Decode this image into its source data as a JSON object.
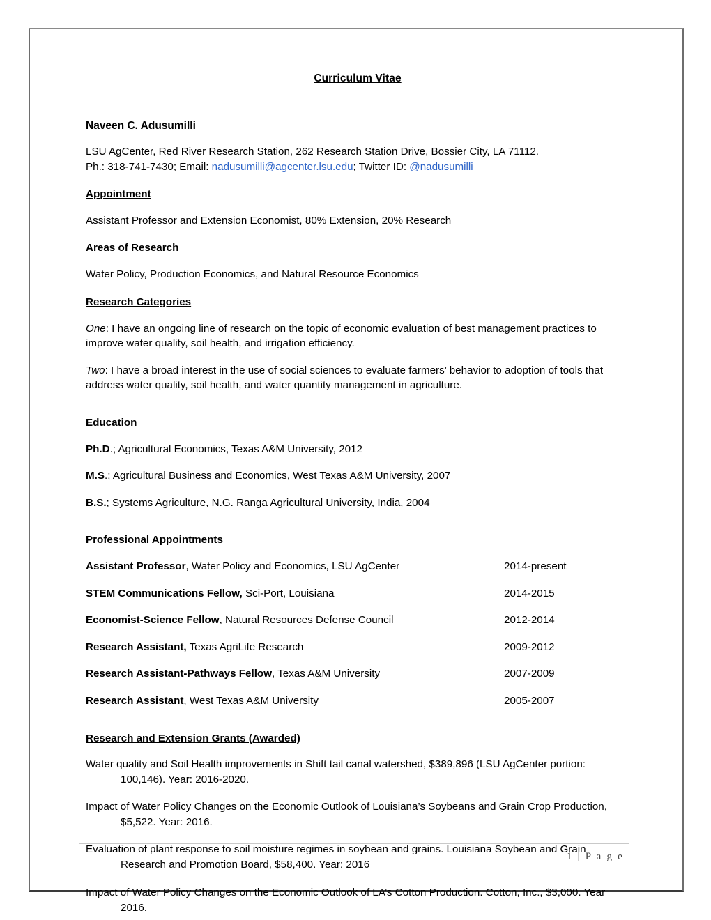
{
  "document": {
    "title": "Curriculum Vitae",
    "name": "Naveen C. Adusumilli",
    "address": "LSU AgCenter, Red River Research Station, 262 Research Station Drive, Bossier City, LA 71112.",
    "contact_prefix": "Ph.: 318-741-7430; Email: ",
    "email": "nadusumilli@agcenter.lsu.edu",
    "contact_middle": "; Twitter ID: ",
    "twitter": "@nadusumilli",
    "link_color": "#2d64c8"
  },
  "sections": {
    "appointment": {
      "heading": "Appointment",
      "text": "Assistant Professor and Extension Economist, 80% Extension, 20% Research"
    },
    "areas_of_research": {
      "heading": "Areas of Research",
      "text": "Water Policy, Production Economics, and Natural Resource Economics"
    },
    "research_categories": {
      "heading": "Research Categories",
      "items": [
        {
          "label": "One",
          "text": ": I have an ongoing line of research on the topic of economic evaluation of best management practices to improve water quality, soil health, and irrigation efficiency."
        },
        {
          "label": "Two",
          "text": ": I have a broad interest in the use of social sciences to evaluate farmers’ behavior to adoption of tools that address water quality, soil health, and water quantity management in agriculture."
        }
      ]
    },
    "education": {
      "heading": "Education",
      "entries": [
        {
          "degree": "Ph.D",
          "detail": ".; Agricultural Economics, Texas A&M University, 2012"
        },
        {
          "degree": "M.S",
          "detail": ".; Agricultural Business and Economics, West Texas A&M University, 2007"
        },
        {
          "degree": "B.S.",
          "detail": "; Systems Agriculture, N.G. Ranga Agricultural University, India, 2004"
        }
      ]
    },
    "professional_appointments": {
      "heading": "Professional Appointments",
      "rows": [
        {
          "title": "Assistant Professor",
          "detail": ", Water Policy and Economics, LSU AgCenter",
          "years": "2014-present"
        },
        {
          "title": "STEM Communications Fellow,",
          "detail": " Sci-Port, Louisiana",
          "years": "2014-2015"
        },
        {
          "title": "Economist-Science Fellow",
          "detail": ", Natural Resources Defense Council",
          "years": "2012-2014"
        },
        {
          "title": "Research Assistant,",
          "detail": " Texas AgriLife Research",
          "years": "2009-2012"
        },
        {
          "title": "Research Assistant-Pathways Fellow",
          "detail": ", Texas A&M University",
          "years": "2007-2009"
        },
        {
          "title": "Research Assistant",
          "detail": ", West Texas A&M University",
          "years": "2005-2007"
        }
      ]
    },
    "grants": {
      "heading": "Research and Extension Grants (Awarded)",
      "entries": [
        "Water quality and Soil Health improvements in Shift tail canal watershed, $389,896 (LSU AgCenter portion: 100,146). Year: 2016-2020.",
        "Impact of Water Policy Changes on the Economic Outlook of Louisiana’s Soybeans and Grain Crop Production, $5,522. Year: 2016.",
        "Evaluation of plant response to soil moisture regimes in soybean and grains. Louisiana Soybean and Grain Research and Promotion Board, $58,400. Year: 2016",
        "Impact of Water Policy Changes on the Economic Outlook of LA’s Cotton Production. Cotton, Inc., $3,000. Year 2016."
      ]
    }
  },
  "footer": {
    "page_number": "1",
    "separator": "|",
    "page_label": "P a g e"
  }
}
